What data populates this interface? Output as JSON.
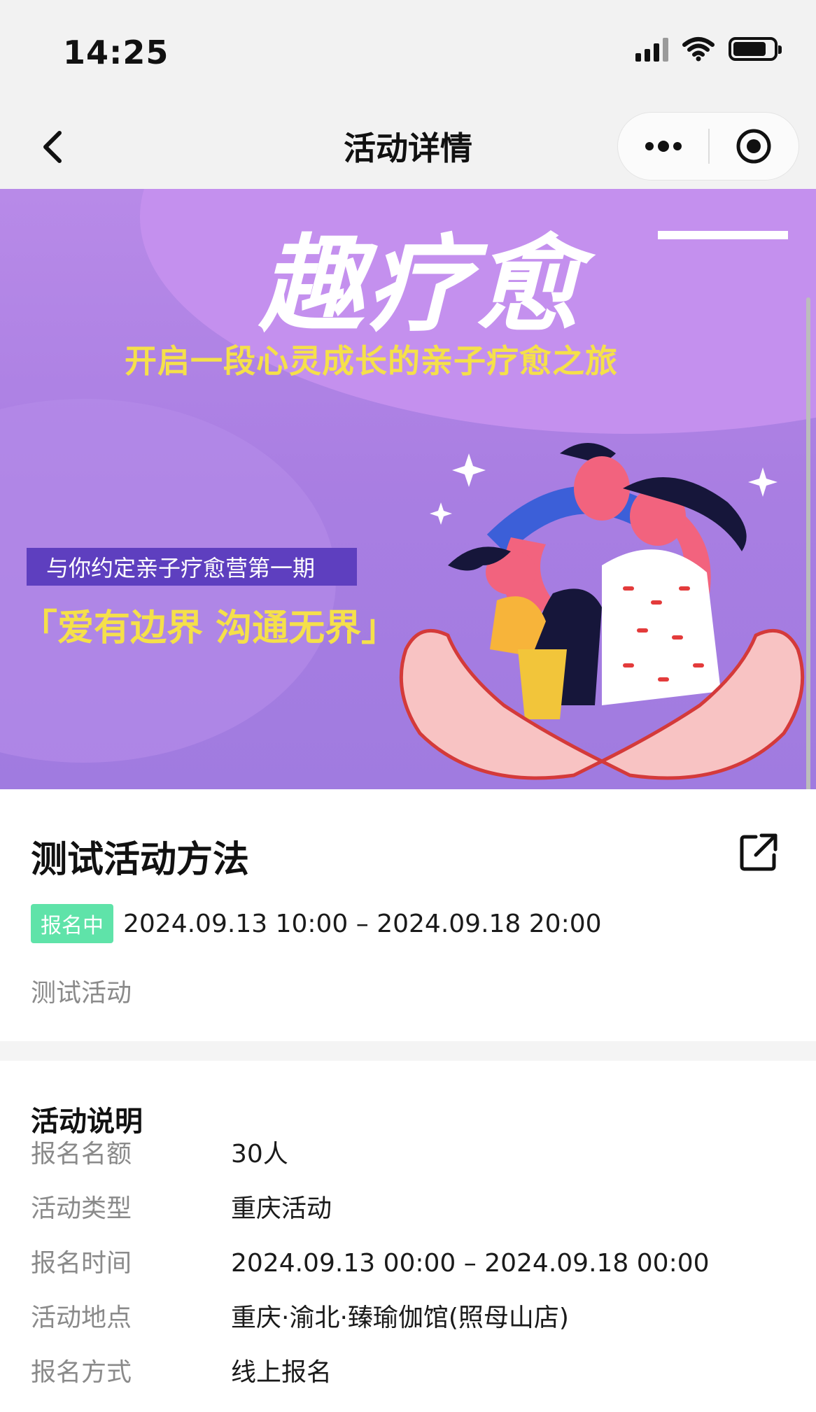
{
  "status_bar": {
    "time": "14:25"
  },
  "nav": {
    "title": "活动详情"
  },
  "banner": {
    "title": "趣疗愈",
    "subtitle": "开启一段心灵成长的亲子疗愈之旅",
    "tag": "与你约定亲子疗愈营第一期",
    "slogan": "「爱有边界 沟通无界」"
  },
  "activity": {
    "title": "测试活动方法",
    "status_badge": "报名中",
    "date_range": "2024.09.13 10:00 – 2024.09.18 20:00",
    "description": "测试活动"
  },
  "details": {
    "heading": "活动说明",
    "rows": [
      {
        "label": "报名名额",
        "value": "30人"
      },
      {
        "label": "活动类型",
        "value": "重庆活动"
      },
      {
        "label": "报名时间",
        "value": "2024.09.13 00:00 – 2024.09.18 00:00"
      },
      {
        "label": "活动地点",
        "value": "重庆·渝北·臻瑜伽馆(照母山店)"
      },
      {
        "label": "报名方式",
        "value": "线上报名"
      }
    ]
  },
  "colors": {
    "badge_green": "#5fe3a9",
    "banner_purple": "#a97ee2",
    "banner_yellow": "#f5e04a",
    "tag_purple": "#5e3fbf"
  },
  "icons": [
    "back-arrow-icon",
    "more-dots-icon",
    "close-target-icon",
    "share-external-icon",
    "signal-icon",
    "wifi-icon",
    "battery-icon"
  ]
}
